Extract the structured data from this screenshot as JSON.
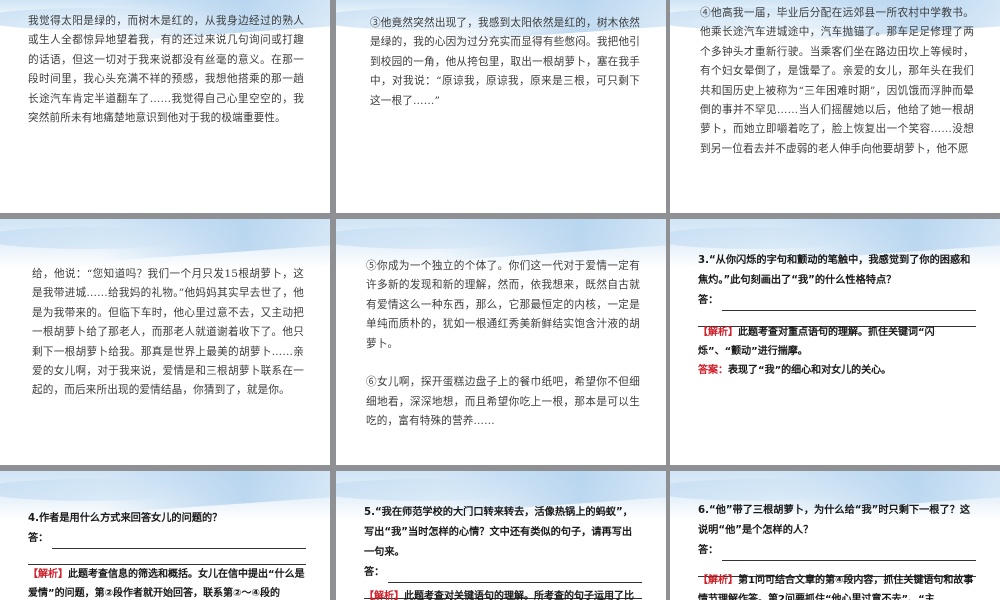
{
  "slides": [
    {
      "text": "我觉得太阳是绿的，而树木是红的，从我身边经过的熟人或生人全都惊异地望着我，有的还过来说几句询问或打趣的话语，但这一切对于我来说都没有丝毫的意义。在那一段时间里，我心头充满不祥的预感，我想他搭乘的那一趟长途汽车肯定半道翻车了……我觉得自己心里空空的，我突然前所未有地痛楚地意识到他对于我的极端重要性。"
    },
    {
      "text": "③他竟然突然出现了，我感到太阳依然是红的，树木依然是绿的，我的心因为过分充实而显得有些憋闷。我把他引到校园的一角，他从挎包里，取出一根胡萝卜，塞在我手中，对我说：“原谅我，原谅我，原来是三根，可只剩下这一根了……”"
    },
    {
      "text": "④他高我一届，毕业后分配在远郊县一所农村中学教书。他乘长途汽车进城途中，汽车抛锚了。那车足足修理了两个多钟头才重新行驶。当乘客们坐在路边田坎上等候时，有个妇女晕倒了，是饿晕了。亲爱的女儿，那年头在我们共和国历史上被称为“三年困难时期”，因饥饿而浮肿而晕倒的事并不罕见……当人们摇醒她以后，他给了她一根胡萝卜，而她立即嚼着吃了，脸上恢复出一个笑容……没想到另一位看去并不虚弱的老人伸手向他要胡萝卜，他不愿"
    },
    {
      "text": "给，他说：“您知道吗？我们一个月只发15根胡萝卜，这是我带进城……给我妈的礼物。”他妈妈其实早去世了，他是为我带来的。但临下车时，他心里过意不去，又主动把一根胡萝卜给了那老人，而那老人就道谢着收下了。他只剩下一根胡萝卜给我。那真是世界上最美的胡萝卜……亲爱的女儿啊，对于我来说，爱情是和三根胡萝卜联系在一起的，而后来所出现的爱情结晶，你猜到了，就是你。"
    },
    {
      "text": "⑤你成为一个独立的个体了。你们这一代对于爱情一定有许多新的发现和新的理解，然而，依我想来，既然自古就有爱情这么一种东西，那么，它那最恒定的内核，一定是单纯而质朴的，犹如一根通红秀美新鲜结实饱含汁液的胡萝卜。\n\n⑥女儿啊，探开蛋糕边盘子上的餐巾纸吧，希望你不但细细地看，深深地想，而且希望你吃上一根，那本是可以生吃的，富有特殊的营养……"
    },
    {
      "question": "3.“从你闪烁的字句和颤动的笔触中，我感觉到了你的困惑和焦灼。”此句刻画出了“我”的什么性格特点？",
      "answer_label": "答：",
      "analysis_label": "【解析】",
      "analysis": "此题考查对重点语句的理解。抓住关键词“闪烁”、“颤动”进行揣摩。",
      "answer_key_label": "答案：",
      "answer_key": "表现了“我”的细心和对女儿的关心。"
    },
    {
      "question": "4.作者是用什么方式来回答女儿的问题的？",
      "answer_label": "答：",
      "analysis_label": "【解析】",
      "analysis": "此题考查信息的筛选和概括。女儿在信中提出“什么是爱情”的问题，第②段作者就开始回答，联系第②～④段的"
    },
    {
      "question": "5.“我在师范学校的大门口转来转去，活像热锅上的蚂蚁”，写出“我”当时怎样的心情？文中还有类似的句子，请再写出一句来。",
      "answer_label": "答：",
      "analysis_label": "【解析】",
      "analysis": "此题考查对关键语句的理解。所考查的句子运用了比"
    },
    {
      "question": "6.“他”带了三根胡萝卜，为什么给“我”时只剩下一根了？这说明“他”是个怎样的人？",
      "answer_label": "答：",
      "analysis_label": "【解析】",
      "analysis": "第1问可结合文章的第④段内容，抓住关键语句和故事情节理解作答。第2问要抓住“他心里过意不去”、“主"
    }
  ],
  "colors": {
    "analysis_red": "#d0202a",
    "banner_blue": "#b4d3ee",
    "background_gray": "#8e9094"
  }
}
